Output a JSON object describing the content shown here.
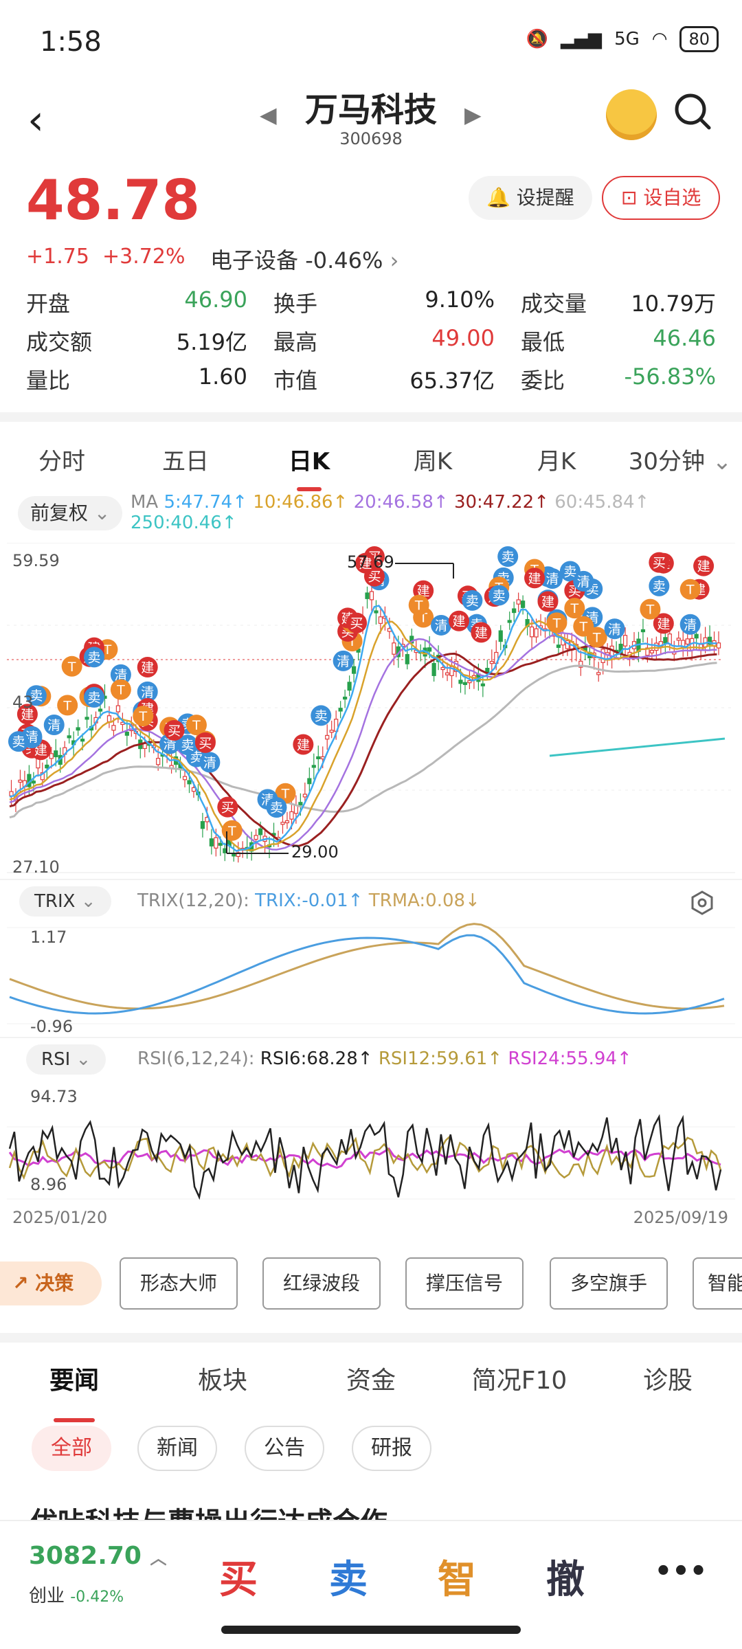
{
  "status_bar": {
    "time": "1:58",
    "network": "5G",
    "battery": "80"
  },
  "header": {
    "name": "万马科技",
    "code": "300698"
  },
  "quote": {
    "price": "48.78",
    "change": "+1.75",
    "change_pct": "+3.72%",
    "sector": "电子设备",
    "sector_change": "-0.46%",
    "alert_label": "设提醒",
    "fav_label": "设自选"
  },
  "stats": [
    [
      {
        "label": "开盘",
        "value": "46.90",
        "color": "green"
      },
      {
        "label": "换手",
        "value": "9.10%",
        "color": "black"
      },
      {
        "label": "成交量",
        "value": "10.79万",
        "color": "black"
      }
    ],
    [
      {
        "label": "成交额",
        "value": "5.19亿",
        "color": "black"
      },
      {
        "label": "最高",
        "value": "49.00",
        "color": "red"
      },
      {
        "label": "最低",
        "value": "46.46",
        "color": "green"
      }
    ],
    [
      {
        "label": "量比",
        "value": "1.60",
        "color": "black"
      },
      {
        "label": "市值",
        "value": "65.37亿",
        "color": "black"
      },
      {
        "label": "委比",
        "value": "-56.83%",
        "color": "green"
      }
    ]
  ],
  "period_tabs": [
    "分时",
    "五日",
    "日K",
    "周K",
    "月K",
    "30分钟"
  ],
  "active_period": "日K",
  "adjust_label": "前复权",
  "ma_legend": {
    "ma_label": "MA",
    "ma5": "5:47.74↑",
    "ma10": "10:46.86↑",
    "ma20": "20:46.58↑",
    "ma30": "30:47.22↑",
    "ma60": "60:45.84↑",
    "ma250": "250:40.46↑"
  },
  "colors": {
    "ma5": "#3da9f0",
    "ma10": "#d9a22b",
    "ma20": "#a472e0",
    "ma30": "#9a2020",
    "ma60": "#b8b8b8",
    "ma250": "#3cc4c4",
    "up": "#e03a3a",
    "down": "#27a04c"
  },
  "kchart": {
    "y_max": "59.59",
    "y_min": "27.10",
    "y_mid": "43",
    "high_label": "57.69",
    "low_label": "29.00",
    "start_date": "2025/01/20",
    "end_date": "2025/09/19"
  },
  "trix": {
    "tag": "TRIX",
    "params": "TRIX(12,20):",
    "trix": "TRIX:-0.01↑",
    "trma": "TRMA:0.08↓",
    "y_top": "1.17",
    "y_bottom": "-0.96"
  },
  "rsi": {
    "tag": "RSI",
    "params": "RSI(6,12,24):",
    "rsi6": "RSI6:68.28↑",
    "rsi12": "RSI12:59.61↑",
    "rsi24": "RSI24:55.94↑",
    "y_top": "94.73",
    "y_bottom": "8.96"
  },
  "decision": "决策",
  "tools": [
    "形态大师",
    "红绿波段",
    "撑压信号",
    "多空旗手",
    "智能"
  ],
  "news_tabs": [
    "要闻",
    "板块",
    "资金",
    "简况F10",
    "诊股"
  ],
  "news_filters": [
    "全部",
    "新闻",
    "公告",
    "研报"
  ],
  "headline": "优咔科技与曹操出行达成合作",
  "bottom_bar": {
    "index_value": "3082.70",
    "index_name": "创业",
    "index_change": "-0.42%",
    "buy": "买",
    "sell": "卖",
    "smart": "智",
    "cancel": "撤",
    "more": "•••"
  }
}
